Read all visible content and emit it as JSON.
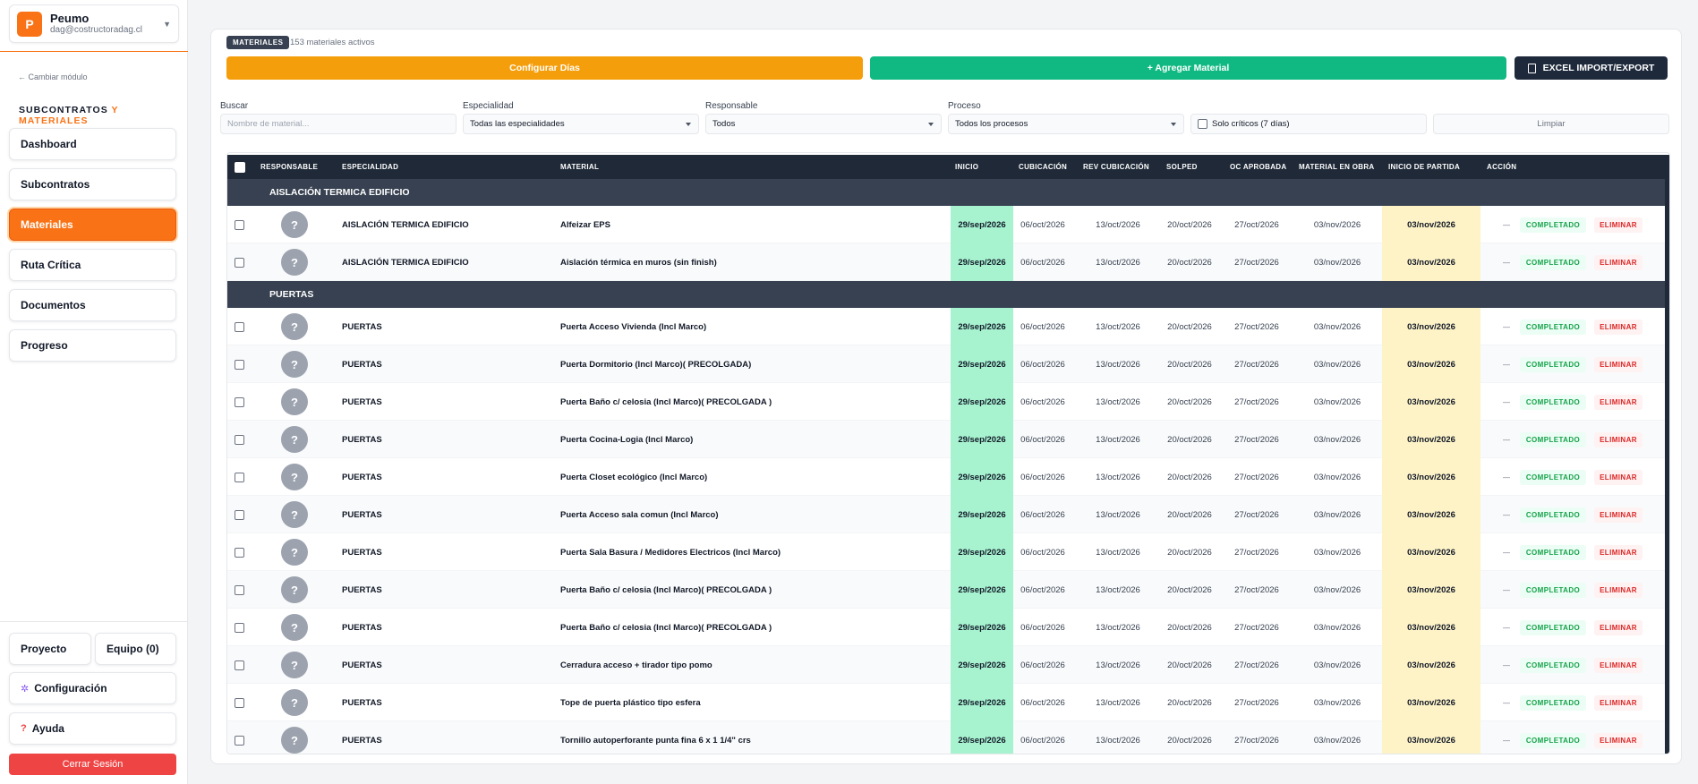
{
  "project": {
    "initial": "P",
    "name": "Peumo",
    "email": "dag@costructoradag.cl"
  },
  "sidebar": {
    "back_link": "← Cambiar módulo",
    "module_title_a": "SUBCONTRATOS ",
    "module_title_b": "Y MATERIALES",
    "items": [
      {
        "label": "Dashboard"
      },
      {
        "label": "Subcontratos"
      },
      {
        "label": "Materiales"
      },
      {
        "label": "Ruta Crítica"
      },
      {
        "label": "Documentos"
      },
      {
        "label": "Progreso"
      }
    ],
    "proyecto": "Proyecto",
    "equipo": "Equipo (0)",
    "config": "Configuración",
    "help": "Ayuda",
    "logout": "Cerrar Sesión",
    "colors": {
      "accent": "#f97316",
      "danger": "#ef4444"
    }
  },
  "header": {
    "tag": "MATERIALES",
    "count": "153 materiales activos"
  },
  "actions": {
    "config": "Configurar Días",
    "add": "+ Agregar Material",
    "excel": "EXCEL IMPORT/EXPORT",
    "colors": {
      "config": "#f59e0b",
      "add": "#10b981",
      "excel": "#1e293b"
    }
  },
  "filters": {
    "search_label": "Buscar",
    "search_placeholder": "Nombre de material...",
    "especialidad_label": "Especialidad",
    "especialidad_value": "Todas las especialidades",
    "responsable_label": "Responsable",
    "responsable_value": "Todos",
    "proceso_label": "Proceso",
    "proceso_value": "Todos los procesos",
    "criticos": "Solo críticos (7 días)",
    "clear": "Limpiar"
  },
  "table": {
    "headers": {
      "responsable": "RESPONSABLE",
      "especialidad": "ESPECIALIDAD",
      "material": "MATERIAL",
      "inicio": "INICIO",
      "cubicacion": "CUBICACIÓN",
      "rev": "REV CUBICACIÓN",
      "solped": "SOLPED",
      "oc": "OC APROBADA",
      "obra": "MATERIAL EN OBRA",
      "partida": "INICIO DE PARTIDA",
      "accion": "ACCIÓN"
    },
    "avatar": "?",
    "dash": "—",
    "completed": "COMPLETADO",
    "delete": "ELIMINAR",
    "groups": [
      {
        "name": "AISLACIÓN TERMICA EDIFICIO",
        "rows": [
          {
            "especialidad": "AISLACIÓN TERMICA EDIFICIO",
            "material": "Alfeizar EPS",
            "inicio": "29/sep/2026",
            "cubicacion": "06/oct/2026",
            "rev": "13/oct/2026",
            "solped": "20/oct/2026",
            "oc": "27/oct/2026",
            "obra": "03/nov/2026",
            "partida": "03/nov/2026"
          },
          {
            "especialidad": "AISLACIÓN TERMICA EDIFICIO",
            "material": "Aislación térmica en muros (sin finish)",
            "inicio": "29/sep/2026",
            "cubicacion": "06/oct/2026",
            "rev": "13/oct/2026",
            "solped": "20/oct/2026",
            "oc": "27/oct/2026",
            "obra": "03/nov/2026",
            "partida": "03/nov/2026"
          }
        ]
      },
      {
        "name": "PUERTAS",
        "rows": [
          {
            "especialidad": "PUERTAS",
            "material": "Puerta Acceso Vivienda (Incl Marco)",
            "inicio": "29/sep/2026",
            "cubicacion": "06/oct/2026",
            "rev": "13/oct/2026",
            "solped": "20/oct/2026",
            "oc": "27/oct/2026",
            "obra": "03/nov/2026",
            "partida": "03/nov/2026"
          },
          {
            "especialidad": "PUERTAS",
            "material": "Puerta Dormitorio (Incl Marco)( PRECOLGADA)",
            "inicio": "29/sep/2026",
            "cubicacion": "06/oct/2026",
            "rev": "13/oct/2026",
            "solped": "20/oct/2026",
            "oc": "27/oct/2026",
            "obra": "03/nov/2026",
            "partida": "03/nov/2026"
          },
          {
            "especialidad": "PUERTAS",
            "material": "Puerta Baño c/ celosia (Incl Marco)( PRECOLGADA )",
            "inicio": "29/sep/2026",
            "cubicacion": "06/oct/2026",
            "rev": "13/oct/2026",
            "solped": "20/oct/2026",
            "oc": "27/oct/2026",
            "obra": "03/nov/2026",
            "partida": "03/nov/2026"
          },
          {
            "especialidad": "PUERTAS",
            "material": "Puerta Cocina-Logia (Incl Marco)",
            "inicio": "29/sep/2026",
            "cubicacion": "06/oct/2026",
            "rev": "13/oct/2026",
            "solped": "20/oct/2026",
            "oc": "27/oct/2026",
            "obra": "03/nov/2026",
            "partida": "03/nov/2026"
          },
          {
            "especialidad": "PUERTAS",
            "material": "Puerta Closet ecológico (Incl Marco)",
            "inicio": "29/sep/2026",
            "cubicacion": "06/oct/2026",
            "rev": "13/oct/2026",
            "solped": "20/oct/2026",
            "oc": "27/oct/2026",
            "obra": "03/nov/2026",
            "partida": "03/nov/2026"
          },
          {
            "especialidad": "PUERTAS",
            "material": "Puerta Acceso sala comun (Incl Marco)",
            "inicio": "29/sep/2026",
            "cubicacion": "06/oct/2026",
            "rev": "13/oct/2026",
            "solped": "20/oct/2026",
            "oc": "27/oct/2026",
            "obra": "03/nov/2026",
            "partida": "03/nov/2026"
          },
          {
            "especialidad": "PUERTAS",
            "material": "Puerta Sala Basura / Medidores Electricos (Incl Marco)",
            "inicio": "29/sep/2026",
            "cubicacion": "06/oct/2026",
            "rev": "13/oct/2026",
            "solped": "20/oct/2026",
            "oc": "27/oct/2026",
            "obra": "03/nov/2026",
            "partida": "03/nov/2026"
          },
          {
            "especialidad": "PUERTAS",
            "material": "Puerta Baño c/ celosia (Incl Marco)( PRECOLGADA )",
            "inicio": "29/sep/2026",
            "cubicacion": "06/oct/2026",
            "rev": "13/oct/2026",
            "solped": "20/oct/2026",
            "oc": "27/oct/2026",
            "obra": "03/nov/2026",
            "partida": "03/nov/2026"
          },
          {
            "especialidad": "PUERTAS",
            "material": "Puerta Baño c/ celosia (Incl Marco)( PRECOLGADA )",
            "inicio": "29/sep/2026",
            "cubicacion": "06/oct/2026",
            "rev": "13/oct/2026",
            "solped": "20/oct/2026",
            "oc": "27/oct/2026",
            "obra": "03/nov/2026",
            "partida": "03/nov/2026"
          },
          {
            "especialidad": "PUERTAS",
            "material": "Cerradura acceso + tirador tipo pomo",
            "inicio": "29/sep/2026",
            "cubicacion": "06/oct/2026",
            "rev": "13/oct/2026",
            "solped": "20/oct/2026",
            "oc": "27/oct/2026",
            "obra": "03/nov/2026",
            "partida": "03/nov/2026"
          },
          {
            "especialidad": "PUERTAS",
            "material": "Tope de puerta plástico tipo esfera",
            "inicio": "29/sep/2026",
            "cubicacion": "06/oct/2026",
            "rev": "13/oct/2026",
            "solped": "20/oct/2026",
            "oc": "27/oct/2026",
            "obra": "03/nov/2026",
            "partida": "03/nov/2026"
          },
          {
            "especialidad": "PUERTAS",
            "material": "Tornillo autoperforante punta fina 6 x 1 1/4\" crs",
            "inicio": "29/sep/2026",
            "cubicacion": "06/oct/2026",
            "rev": "13/oct/2026",
            "solped": "20/oct/2026",
            "oc": "27/oct/2026",
            "obra": "03/nov/2026",
            "partida": "03/nov/2026"
          }
        ]
      }
    ]
  }
}
